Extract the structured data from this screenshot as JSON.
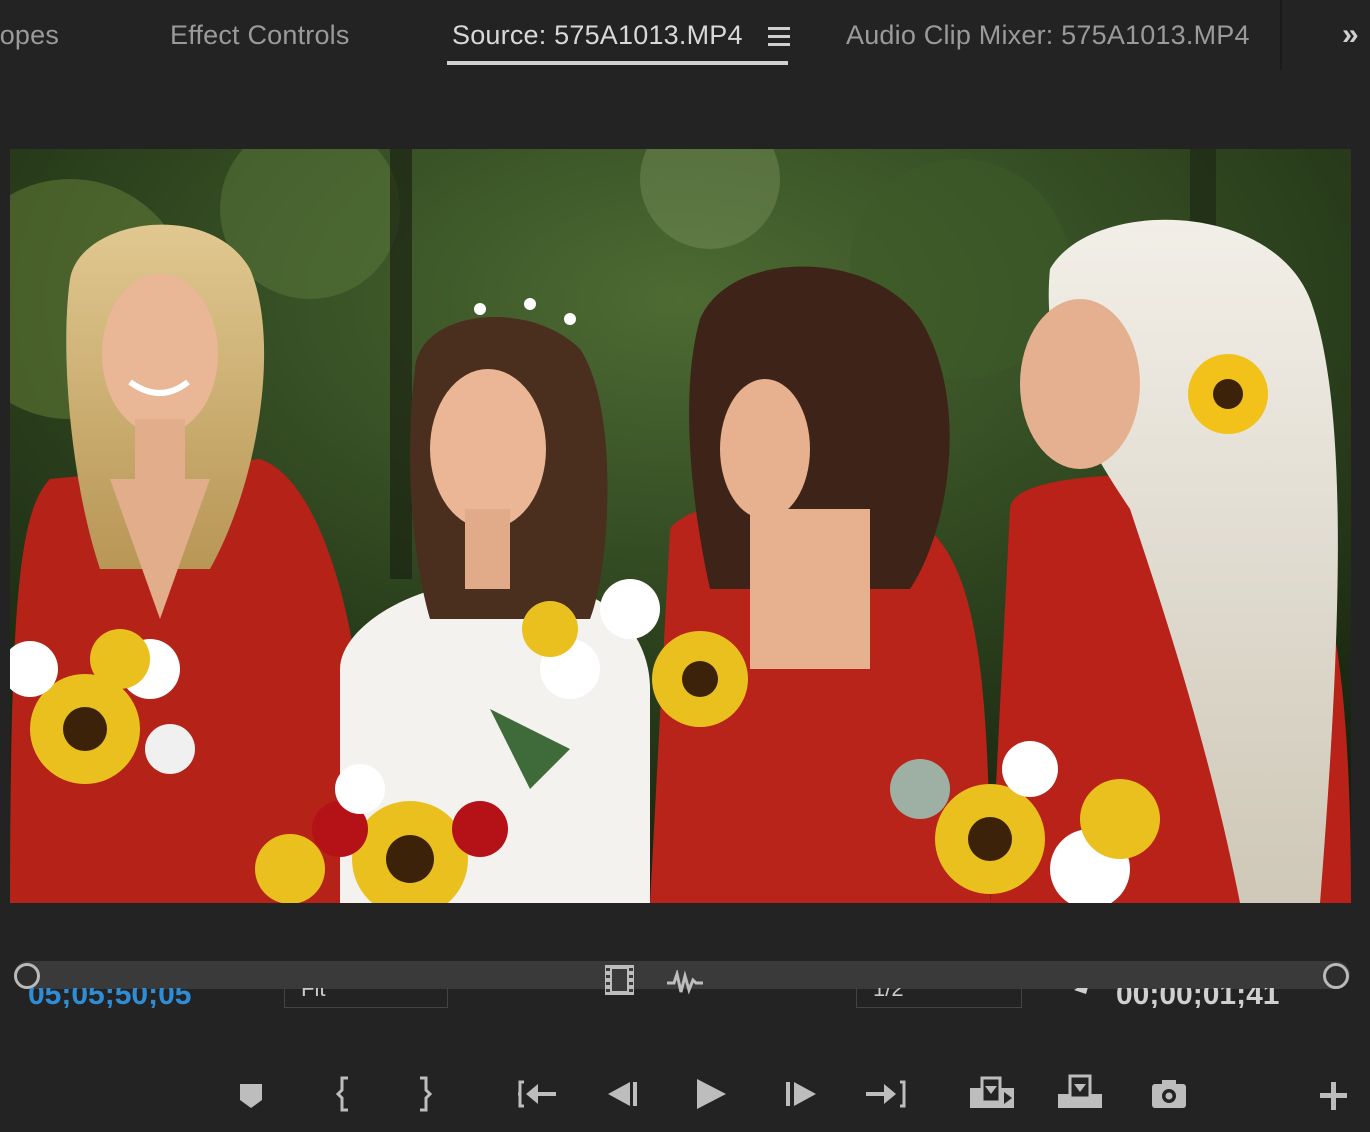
{
  "tabs": [
    {
      "label": "copes",
      "active": false
    },
    {
      "label": "Effect Controls",
      "active": false
    },
    {
      "label": "Source: 575A1013.MP4",
      "active": true
    },
    {
      "label": "Audio Clip Mixer: 575A1013.MP4",
      "active": false
    }
  ],
  "colors": {
    "accent_timecode": "#2f8dd6",
    "panel_bg": "#232323"
  },
  "timecode": {
    "playhead": "05;05;50;05",
    "duration": "00;00;01;41"
  },
  "view": {
    "fit": "Fit",
    "resolution": "1/2"
  },
  "icons": {
    "tab_menu": "hamburger-menu-icon",
    "overflow": "chevron-double-right-icon",
    "drag_video": "drag-video-only-icon",
    "drag_audio": "drag-audio-only-icon",
    "transport": [
      "add-marker-icon",
      "mark-in-icon",
      "mark-out-icon",
      "go-to-in-icon",
      "step-back-icon",
      "play-icon",
      "step-forward-icon",
      "go-to-out-icon",
      "insert-icon",
      "overwrite-icon",
      "export-frame-icon",
      "button-editor-plus-icon"
    ]
  }
}
